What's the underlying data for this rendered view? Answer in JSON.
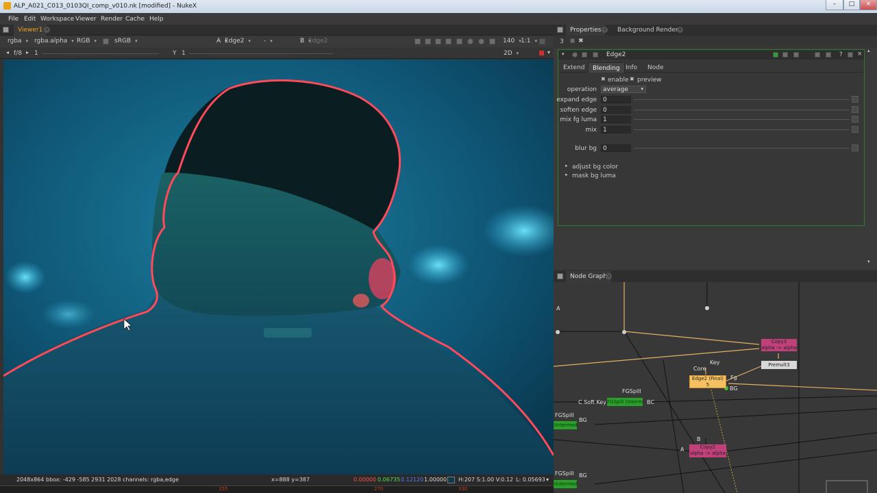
{
  "window": {
    "title": "ALP_A021_C013_0103QI_comp_v010.nk [modified] - NukeX"
  },
  "menu": [
    "File",
    "Edit",
    "Workspace",
    "Viewer",
    "Render",
    "Cache",
    "Help"
  ],
  "viewer_tab": {
    "label": "Viewer1"
  },
  "viewer_controls": {
    "channels": "rgba",
    "alpha": "rgba.alpha",
    "display": "RGB",
    "lut": "sRGB",
    "input_a_label": "A",
    "input_a": "Edge2",
    "dash": "-",
    "input_b_label": "B",
    "input_b": "Edge2",
    "zoom": "140",
    "ratio": "1:1",
    "fstop": "f/8",
    "frame": "1",
    "y_label": "Y",
    "y_value": "1",
    "mode": "2D"
  },
  "status": {
    "format": "2048x864",
    "bbox": "bbox: -429 -585 2931 2028 channels: rgba,edge",
    "coords": "x=888 y=387",
    "r": "0.00000",
    "g": "0.06735",
    "b": "0.12120",
    "a": "1.00000",
    "swatch_color": "#0d3a4e",
    "hsv": "H:207 S:1.00 V:0.12",
    "lum": "L: 0.05693"
  },
  "timeline": [
    "155",
    "270",
    "330"
  ],
  "panel_tabs": [
    "Properties",
    "Background Renders"
  ],
  "panel_count": "3",
  "node_props": {
    "name": "Edge2",
    "tabs": [
      "Extend",
      "Blending",
      "Info",
      "Node"
    ],
    "active_tab": "Blending",
    "enable_label": "enable",
    "preview_label": "preview",
    "operation_label": "operation",
    "operation_value": "average",
    "params": [
      {
        "label": "expand edge",
        "value": "0"
      },
      {
        "label": "soften edge",
        "value": "0"
      },
      {
        "label": "mix fg luma",
        "value": "1"
      },
      {
        "label": "mix",
        "value": "1"
      }
    ],
    "blur": {
      "label": "blur bg",
      "value": "0"
    },
    "groups": [
      "adjust bg color",
      "mask bg luma"
    ]
  },
  "node_graph": {
    "tab": "Node Graph",
    "nodes": {
      "copy3": "Copy3",
      "copy3_sub": "alpha -> alpha",
      "premult": "Premult3",
      "edge2": "Edge2 (Final)",
      "edge2_sub": "5",
      "copy2": "Copy2",
      "copy2_sub": "alpha -> alpha",
      "green1": "FGSpill (Intermediate)",
      "green2": "(Intermediate)",
      "green3": "(Intermediate)"
    },
    "labels": {
      "a": "A",
      "key": "Key",
      "core": "Core",
      "fg": "Fg",
      "bg": "BG",
      "fgspill1": "FGSpill",
      "soft_key": "C Soft Key",
      "bc": "BC",
      "fgspill2": "FGSpill",
      "bg2": "BG",
      "b": "B",
      "a2": "A",
      "fgspill3": "FGSpill",
      "bg3": "BG"
    }
  },
  "colors": {
    "accent": "#f0a020",
    "edge_outline": "#ff4a5a",
    "node_copy": "#c0407a",
    "node_edge": "#f5c060",
    "node_spill": "#2aa02a"
  }
}
